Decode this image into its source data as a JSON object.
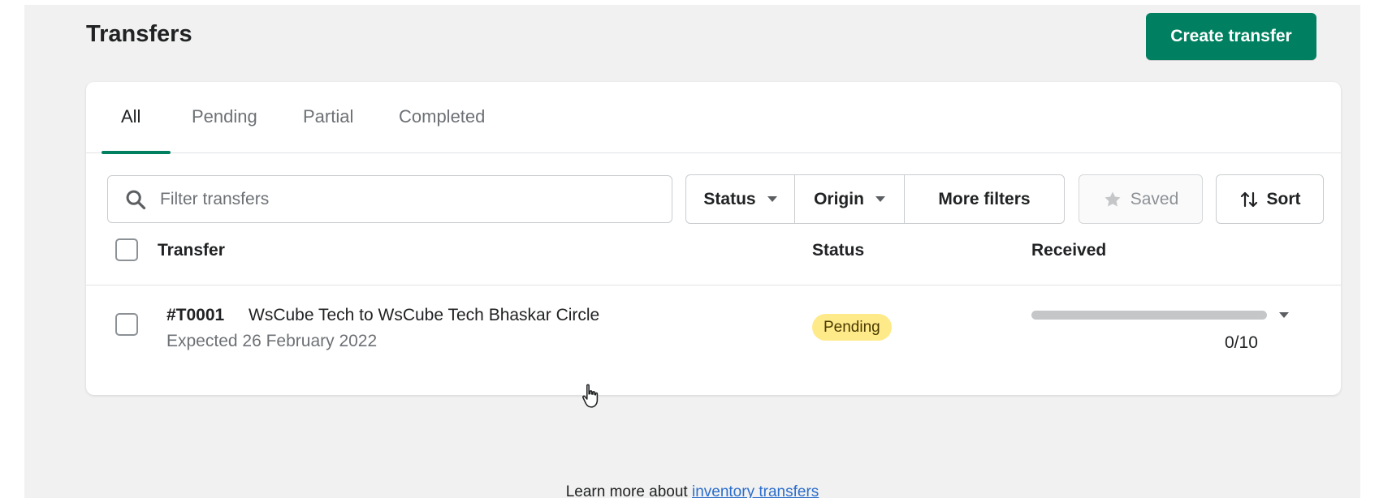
{
  "page": {
    "title": "Transfers",
    "create_button": "Create transfer"
  },
  "tabs": [
    "All",
    "Pending",
    "Partial",
    "Completed"
  ],
  "active_tab": "All",
  "search": {
    "placeholder": "Filter transfers"
  },
  "filters": {
    "status": "Status",
    "origin": "Origin",
    "more": "More filters",
    "saved": "Saved",
    "sort": "Sort"
  },
  "table": {
    "columns": {
      "transfer": "Transfer",
      "status": "Status",
      "received": "Received"
    },
    "rows": [
      {
        "id": "#T0001",
        "name": "WsCube Tech to WsCube Tech Bhaskar Circle",
        "expected": "Expected 26 February 2022",
        "status": "Pending",
        "received_text": "0/10",
        "received_fraction": 0
      }
    ]
  },
  "footer": {
    "prefix": "Learn more about ",
    "link": "inventory transfers"
  },
  "colors": {
    "primary": "#008060",
    "pending_badge": "#ffea8a",
    "link": "#2c6ecb"
  },
  "icons": [
    "search-icon",
    "star-icon",
    "sort-arrows-icon",
    "caret-down-icon",
    "pointer-cursor-icon"
  ]
}
